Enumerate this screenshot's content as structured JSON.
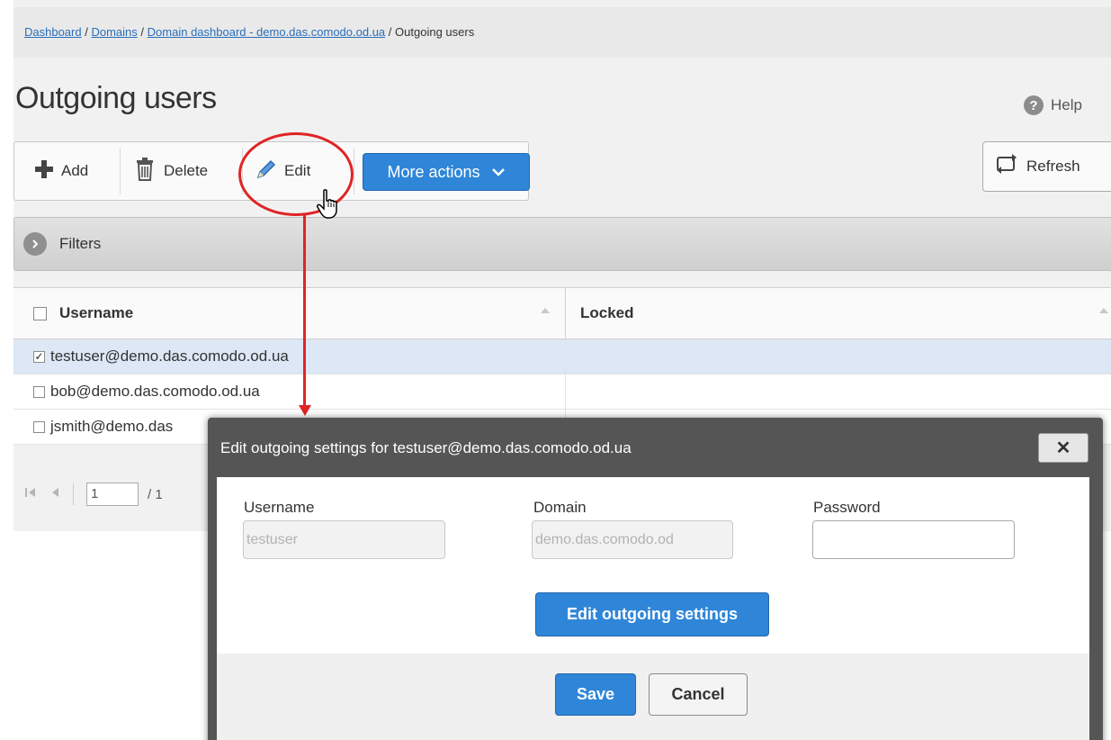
{
  "breadcrumb": {
    "items": [
      "Dashboard",
      "Domains",
      "Domain dashboard - demo.das.comodo.od.ua"
    ],
    "current": "Outgoing users",
    "separator": "/"
  },
  "page": {
    "title": "Outgoing users",
    "help_label": "Help",
    "help_icon": "?"
  },
  "toolbar": {
    "add_label": "Add",
    "delete_label": "Delete",
    "edit_label": "Edit",
    "more_actions_label": "More actions",
    "refresh_label": "Refresh"
  },
  "filters": {
    "label": "Filters"
  },
  "table": {
    "columns": [
      "Username",
      "Locked"
    ],
    "rows": [
      {
        "username": "testuser@demo.das.comodo.od.ua",
        "locked": "",
        "checked": true
      },
      {
        "username": "bob@demo.das.comodo.od.ua",
        "locked": "",
        "checked": false
      },
      {
        "username": "jsmith@demo.das",
        "locked": "",
        "checked": false
      }
    ]
  },
  "pager": {
    "page_value": "1",
    "total_text": "/ 1"
  },
  "modal": {
    "title": "Edit outgoing settings for testuser@demo.das.comodo.od.ua",
    "close_label": "✕",
    "username_label": "Username",
    "username_value": "testuser",
    "domain_label": "Domain",
    "domain_value": "demo.das.comodo.od",
    "password_label": "Password",
    "password_value": "",
    "edit_button_label": "Edit outgoing settings",
    "save_label": "Save",
    "cancel_label": "Cancel"
  },
  "colors": {
    "primary_button": "#2f86d8",
    "annotation": "#e02424",
    "selected_row": "#dde7f5",
    "link": "#2a6ebb"
  },
  "icons": [
    "plus-icon",
    "trash-icon",
    "pencil-icon",
    "chevron-down-icon",
    "refresh-icon",
    "filters-arrow-icon",
    "help-icon",
    "close-icon",
    "first-page-icon",
    "prev-page-icon",
    "pointer-cursor-icon"
  ]
}
